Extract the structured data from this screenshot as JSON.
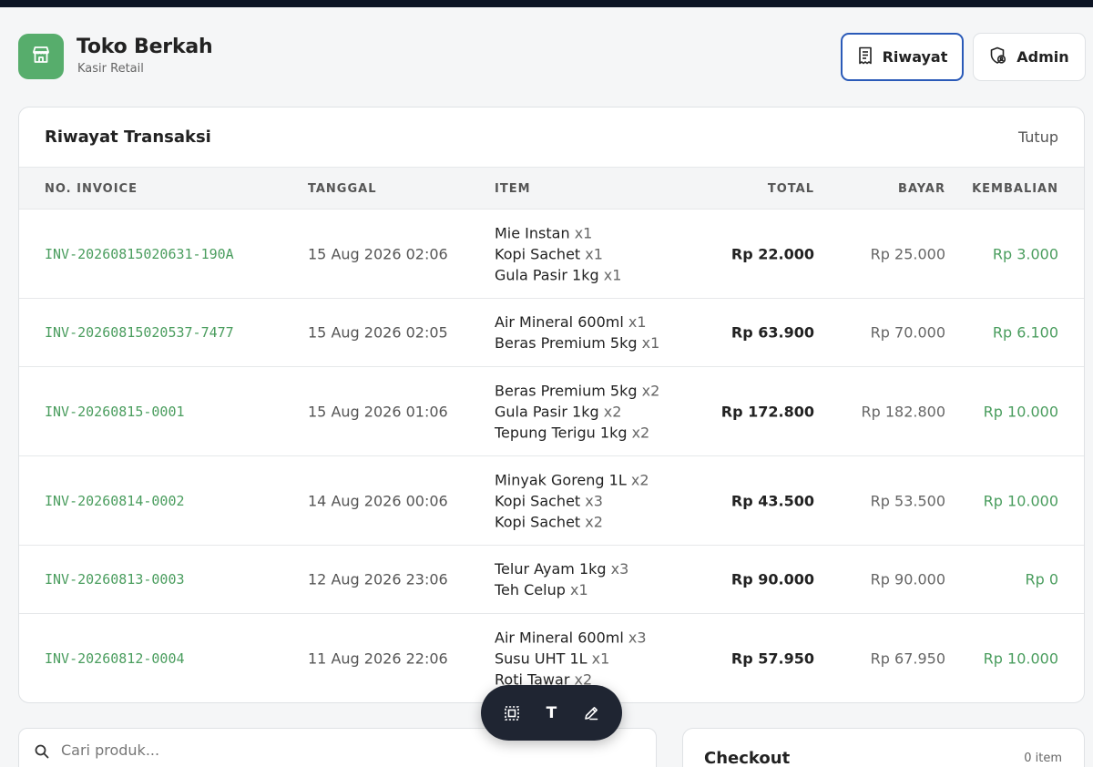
{
  "brand": {
    "title": "Toko Berkah",
    "subtitle": "Kasir Retail"
  },
  "header_buttons": {
    "riwayat": "Riwayat",
    "admin": "Admin"
  },
  "history": {
    "title": "Riwayat Transaksi",
    "close_label": "Tutup",
    "columns": [
      "NO. INVOICE",
      "TANGGAL",
      "ITEM",
      "TOTAL",
      "BAYAR",
      "KEMBALIAN"
    ],
    "rows": [
      {
        "invoice": "INV-20260815020631-190A",
        "date": "15 Aug 2026 02:06",
        "items": [
          {
            "name": "Mie Instan",
            "qty": "x1"
          },
          {
            "name": "Kopi Sachet",
            "qty": "x1"
          },
          {
            "name": "Gula Pasir 1kg",
            "qty": "x1"
          }
        ],
        "total": "Rp 22.000",
        "bayar": "Rp 25.000",
        "kembalian": "Rp 3.000"
      },
      {
        "invoice": "INV-20260815020537-7477",
        "date": "15 Aug 2026 02:05",
        "items": [
          {
            "name": "Air Mineral 600ml",
            "qty": "x1"
          },
          {
            "name": "Beras Premium 5kg",
            "qty": "x1"
          }
        ],
        "total": "Rp 63.900",
        "bayar": "Rp 70.000",
        "kembalian": "Rp 6.100"
      },
      {
        "invoice": "INV-20260815-0001",
        "date": "15 Aug 2026 01:06",
        "items": [
          {
            "name": "Beras Premium 5kg",
            "qty": "x2"
          },
          {
            "name": "Gula Pasir 1kg",
            "qty": "x2"
          },
          {
            "name": "Tepung Terigu 1kg",
            "qty": "x2"
          }
        ],
        "total": "Rp 172.800",
        "bayar": "Rp 182.800",
        "kembalian": "Rp 10.000"
      },
      {
        "invoice": "INV-20260814-0002",
        "date": "14 Aug 2026 00:06",
        "items": [
          {
            "name": "Minyak Goreng 1L",
            "qty": "x2"
          },
          {
            "name": "Kopi Sachet",
            "qty": "x3"
          },
          {
            "name": "Kopi Sachet",
            "qty": "x2"
          }
        ],
        "total": "Rp 43.500",
        "bayar": "Rp 53.500",
        "kembalian": "Rp 10.000"
      },
      {
        "invoice": "INV-20260813-0003",
        "date": "12 Aug 2026 23:06",
        "items": [
          {
            "name": "Telur Ayam 1kg",
            "qty": "x3"
          },
          {
            "name": "Teh Celup",
            "qty": "x1"
          }
        ],
        "total": "Rp 90.000",
        "bayar": "Rp 90.000",
        "kembalian": "Rp 0"
      },
      {
        "invoice": "INV-20260812-0004",
        "date": "11 Aug 2026 22:06",
        "items": [
          {
            "name": "Air Mineral 600ml",
            "qty": "x3"
          },
          {
            "name": "Susu UHT 1L",
            "qty": "x1"
          },
          {
            "name": "Roti Tawar",
            "qty": "x2"
          }
        ],
        "total": "Rp 57.950",
        "bayar": "Rp 67.950",
        "kembalian": "Rp 10.000"
      }
    ]
  },
  "toolbar": {
    "text_tool_label": "T"
  },
  "search": {
    "placeholder": "Cari produk..."
  },
  "checkout": {
    "title": "Checkout",
    "count": "0 item"
  },
  "icons": {
    "logo": "storefront-icon",
    "riwayat": "receipt-icon",
    "admin": "shield-user-icon",
    "select": "select-frame-icon",
    "text": "text-icon",
    "edit": "pencil-edit-icon",
    "search": "search-icon"
  },
  "colors": {
    "brand": "#57ad6c",
    "accent_green": "#4a9d5e",
    "active_border": "#2a5ab8",
    "toolbar_bg": "#1f2532"
  }
}
